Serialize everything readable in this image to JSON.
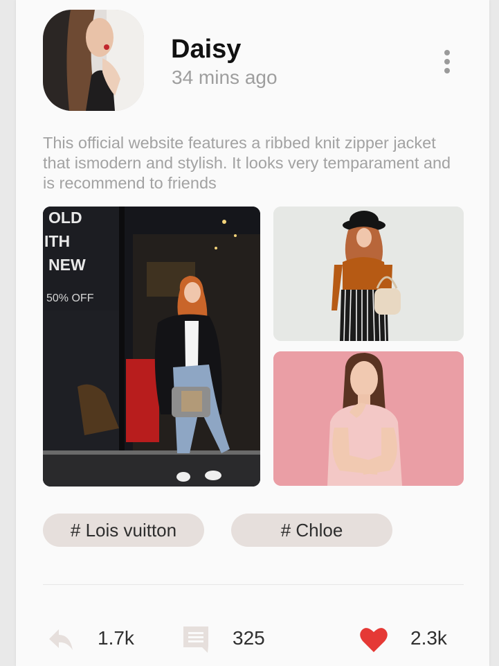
{
  "post": {
    "author": "Daisy",
    "time_ago": "34 mins ago",
    "description": "This official website features a ribbed knit zipper jacket that ismodern and stylish. It looks very temparament and is recommend to friends",
    "storefront_sign": {
      "line1": "OLD",
      "line2": "ITH",
      "line3": "NEW",
      "offer": "50% OFF"
    }
  },
  "tags": [
    {
      "label": "# Lois vuitton"
    },
    {
      "label": "# Chloe"
    }
  ],
  "stats": {
    "shares": "1.7k",
    "comments": "325",
    "likes": "2.3k"
  },
  "icons": {
    "menu": "more-vertical-icon",
    "share": "share-arrow-icon",
    "comment": "comment-icon",
    "like": "heart-icon"
  },
  "colors": {
    "like": "#e53935",
    "tag_bg": "#e6dfdc",
    "muted_text": "#9e9e9e"
  }
}
